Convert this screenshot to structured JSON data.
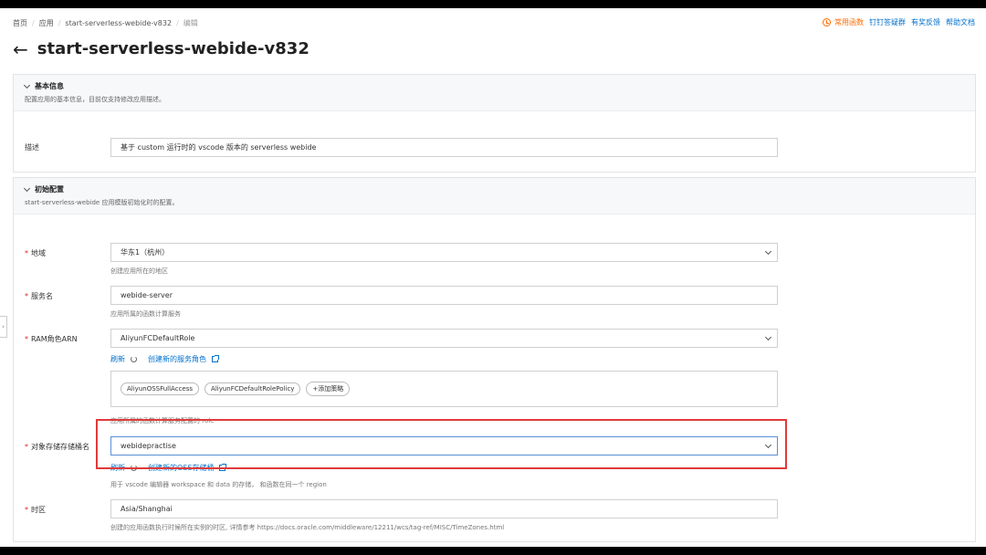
{
  "breadcrumb": [
    "首页",
    "应用",
    "start-serverless-webide-v832",
    "编辑"
  ],
  "top_links": {
    "common_functions": "常用函数",
    "dingtalk_group": "钉钉答疑群",
    "feedback": "有奖反馈",
    "help_docs": "帮助文档"
  },
  "page_title": "start-serverless-webide-v832",
  "basic": {
    "title": "基本信息",
    "desc": "配置应用的基本信息，目前仅支持修改应用描述。",
    "desc_label": "描述",
    "desc_value": "基于 custom 运行时的 vscode 版本的 serverless webide"
  },
  "init": {
    "title": "初始配置",
    "desc": "start-serverless-webide 应用模版初始化时的配置。",
    "region_label": "地域",
    "region_value": "华东1（杭州）",
    "region_hint": "创建应用所在的地区",
    "service_label": "服务名",
    "service_value": "webide-server",
    "service_hint": "应用所属的函数计算服务",
    "ram_label": "RAM角色ARN",
    "ram_value": "AliyunFCDefaultRole",
    "ram_refresh": "刷新",
    "ram_create": "创建新的服务角色",
    "policies": [
      "AliyunOSSFullAccess",
      "AliyunFCDefaultRolePolicy"
    ],
    "add_policy": "+添加策略",
    "ram_hint": "应用所属的函数计算服务配置的 role",
    "bucket_label": "对象存储存储桶名",
    "bucket_value": "webidepractise",
    "bucket_refresh": "刷新",
    "bucket_create": "创建新的OSS存储桶",
    "bucket_hint": "用于 vscode 编辑器 workspace 和 data 的存储， 和函数在同一个 region",
    "tz_label": "时区",
    "tz_value": "Asia/Shanghai",
    "tz_hint": "创建的应用函数执行时候所在实例的时区, 详情参考 https://docs.oracle.com/middleware/12211/wcs/tag-ref/MISC/TimeZones.html"
  },
  "colors": {
    "accent": "#0070cc",
    "warning": "#ff6a00",
    "required": "#e02020",
    "highlight": "#e03a3a"
  }
}
